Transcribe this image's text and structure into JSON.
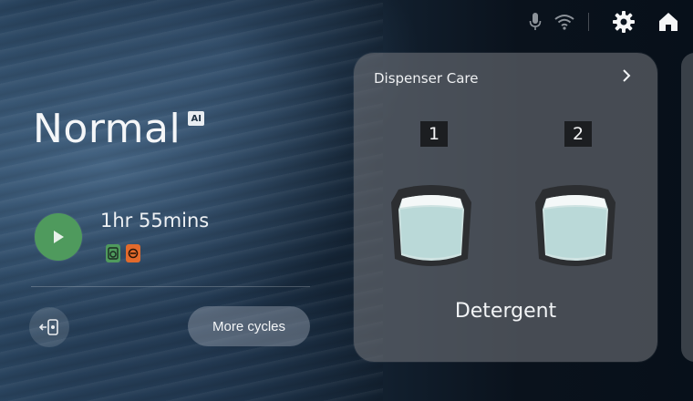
{
  "topbar": {
    "icons": [
      "mic-icon",
      "wifi-icon",
      "gear-icon",
      "home-icon"
    ]
  },
  "cycle": {
    "name": "Normal",
    "ai_badge": "AI",
    "duration": "1hr 55mins",
    "option_icons": [
      "wash-icon",
      "eco-icon"
    ]
  },
  "controls": {
    "more_cycles_label": "More cycles"
  },
  "dispenser": {
    "title": "Dispenser Care",
    "slots": [
      {
        "number": "1"
      },
      {
        "number": "2"
      }
    ],
    "label": "Detergent"
  },
  "colors": {
    "play": "#4f9a5d",
    "eco": "#e26a2c",
    "card": "#6c7076"
  }
}
